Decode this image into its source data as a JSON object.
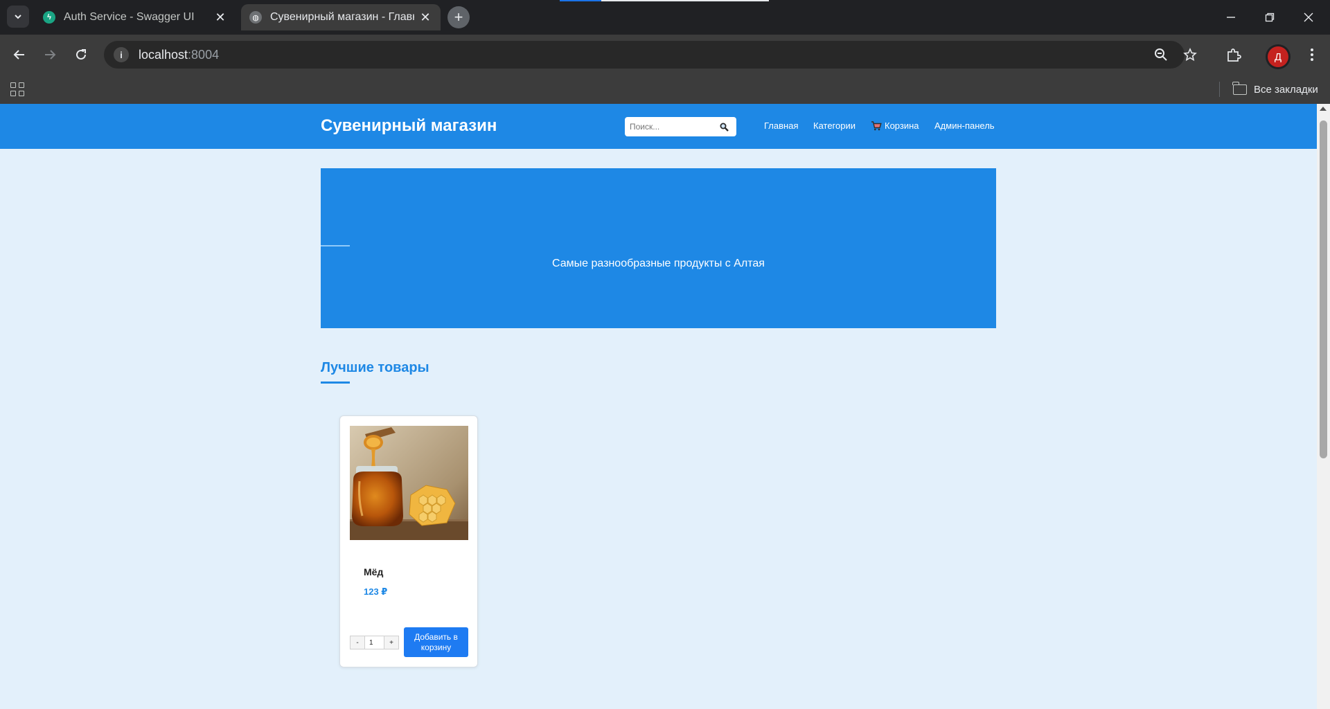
{
  "browser": {
    "tabs": [
      {
        "title": "Auth Service - Swagger UI",
        "favicon": "fastapi-icon",
        "active": false
      },
      {
        "title": "Сувенирный магазин - Главная",
        "favicon": "globe-icon",
        "active": true
      }
    ],
    "url_host": "localhost",
    "url_port": ":8004",
    "profile_initial": "Д",
    "bookmarks_all_label": "Все закладки"
  },
  "site": {
    "logo": "Сувенирный магазин",
    "search_placeholder": "Поиск...",
    "nav": {
      "home": "Главная",
      "categories": "Категории",
      "cart": "Корзина",
      "admin": "Админ-панель"
    },
    "hero_text": "Самые разнообразные продукты с Алтая",
    "section_title": "Лучшие товары"
  },
  "products": [
    {
      "name": "Мёд",
      "price": "123 ₽",
      "quantity": "1",
      "add_button": "Добавить в корзину",
      "decrement_label": "-",
      "increment_label": "+"
    }
  ],
  "colors": {
    "brand": "#1e88e5",
    "page_bg": "#e3f0fb",
    "add_button": "#1e7bf2"
  }
}
